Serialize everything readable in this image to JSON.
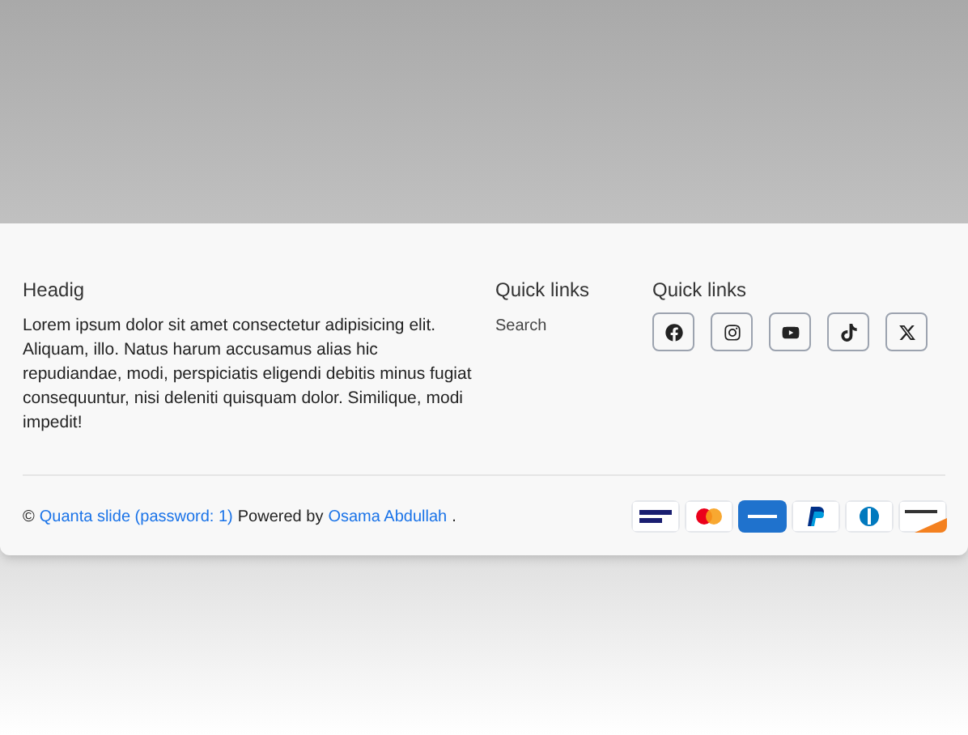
{
  "about": {
    "heading": "Headig",
    "text": "Lorem ipsum dolor sit amet consectetur adipisicing elit. Aliquam, illo. Natus harum accusamus alias hic repudiandae, modi, perspiciatis eligendi debitis minus fugiat consequuntur, nisi deleniti quisquam dolor. Similique, modi impedit!"
  },
  "links": {
    "heading": "Quick links",
    "items": [
      "Search"
    ]
  },
  "social": {
    "heading": "Quick links",
    "buttons": [
      {
        "kind": "facebook"
      },
      {
        "kind": "instagram"
      },
      {
        "kind": "youtube"
      },
      {
        "kind": "tiktok"
      },
      {
        "kind": "x"
      }
    ]
  },
  "copyright": {
    "symbol": "©",
    "site_link": "Quanta slide (password: 1)",
    "middle": "Powered by",
    "author_link": "Osama Abdullah",
    "end": "."
  },
  "payments": [
    {
      "kind": "visa"
    },
    {
      "kind": "mastercard"
    },
    {
      "kind": "amex"
    },
    {
      "kind": "paypal"
    },
    {
      "kind": "diners"
    },
    {
      "kind": "discover"
    }
  ]
}
